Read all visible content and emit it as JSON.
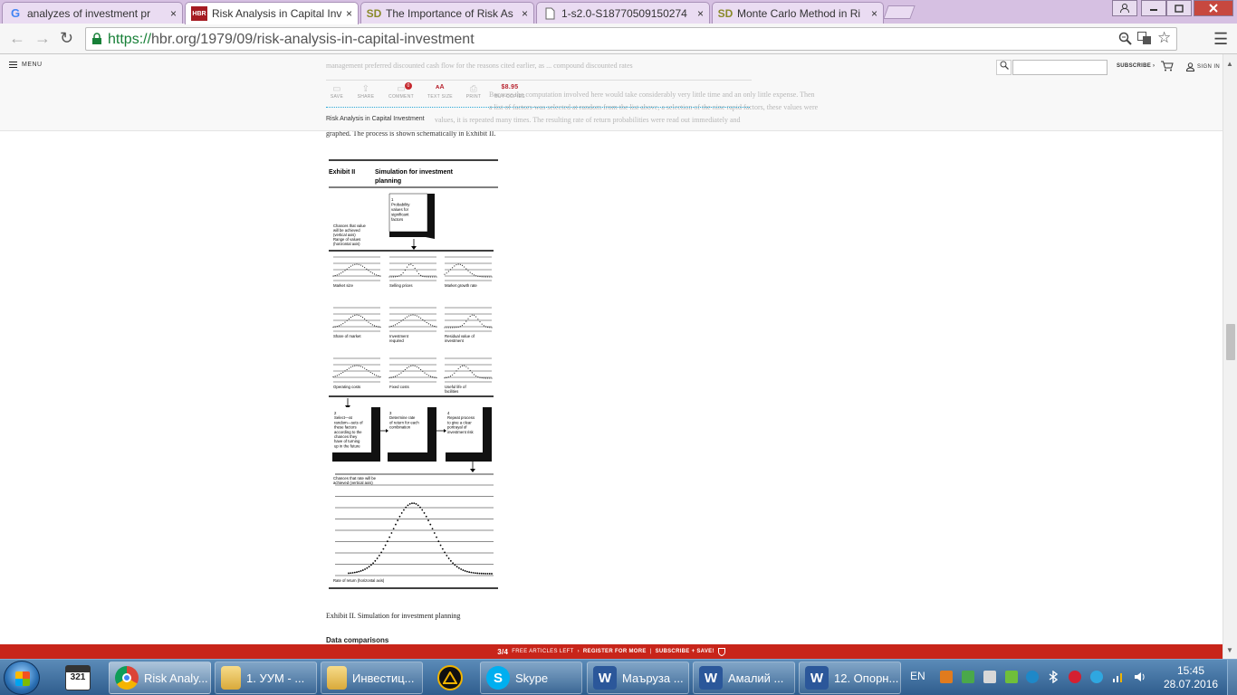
{
  "browser": {
    "tabs": [
      {
        "title": "analyzes of investment pr",
        "favicon": "google-icon",
        "active": false
      },
      {
        "title": "Risk Analysis in Capital Inv",
        "favicon": "hbr-icon",
        "active": true
      },
      {
        "title": "The Importance of Risk As",
        "favicon": "sciencedirect-icon",
        "active": false
      },
      {
        "title": "1-s2.0-S18770509150274",
        "favicon": "document-icon",
        "active": false
      },
      {
        "title": "Monte Carlo Method in Ri",
        "favicon": "sciencedirect-icon",
        "active": false
      }
    ],
    "hbr_favicon_text": "HBR",
    "sd_favicon_text": "SD",
    "close_glyph": "×",
    "url_scheme": "https://",
    "url_rest": "hbr.org/1979/09/risk-analysis-in-capital-investment"
  },
  "site": {
    "menu_label": "MENU",
    "search_placeholder": "",
    "subscribe_label": "SUBSCRIBE",
    "signin_label": "SIGN IN",
    "ghost_line_1": "management preferred discounted cash flow for the reasons cited earlier, as ... compound discounted rates",
    "ghost_line_2": "Because the computation involved here would take considerably very little time and an only little expense. Then",
    "ghost_line_3": "a list of factors was selected at random from the list above, a selection of the nine rapid factors, these values were",
    "ghost_line_4": "values, it is repeated many times. The resulting rate of return probabilities were read out immediately and",
    "toolbar": [
      {
        "label": "SAVE",
        "icon": "folder-icon",
        "glyph": "▭"
      },
      {
        "label": "SHARE",
        "icon": "share-icon",
        "glyph": "⇪"
      },
      {
        "label": "COMMENT",
        "icon": "comment-icon",
        "glyph": "▭",
        "badge": "0"
      },
      {
        "label": "TEXT SIZE",
        "icon": "text-size-icon",
        "glyph": "ᴀA"
      },
      {
        "label": "PRINT",
        "icon": "print-icon",
        "glyph": "⎙"
      },
      {
        "label": "BUY COPIES",
        "icon": "price-icon",
        "glyph": "$8.95"
      }
    ],
    "article_title": "Risk Analysis in Capital Investment"
  },
  "article": {
    "body_tail": "graphed. The process is shown schematically in Exhibit II.",
    "caption": "Exhibit II. Simulation for investment planning",
    "next_heading": "Data comparisons"
  },
  "exhibit": {
    "label": "Exhibit II",
    "title_line1": "Simulation for investment",
    "title_line2": "planning",
    "step1_lines": [
      "1",
      "Probability",
      "values for",
      "significant",
      "factors"
    ],
    "axis_note_lines": [
      "Chances that value",
      "will be achieved",
      "(vertical axis)",
      "Range of values",
      "(horizontal axis)"
    ],
    "factors": [
      {
        "label": [
          "Market size"
        ]
      },
      {
        "label": [
          "Selling prices"
        ]
      },
      {
        "label": [
          "Market growth rate"
        ]
      },
      {
        "label": [
          "Share of market"
        ]
      },
      {
        "label": [
          "Investment",
          "required"
        ]
      },
      {
        "label": [
          "Residual value of",
          "investment"
        ]
      },
      {
        "label": [
          "Operating costs"
        ]
      },
      {
        "label": [
          "Fixed costs"
        ]
      },
      {
        "label": [
          "Useful life of",
          "facilities"
        ]
      }
    ],
    "step2_lines": [
      "2",
      "Select—at",
      "random—sets of",
      "these factors",
      "according to the",
      "chances they",
      "have of turning",
      "up in the future"
    ],
    "step3_lines": [
      "3",
      "Determine rate",
      "of return for each",
      "combination"
    ],
    "step4_lines": [
      "4",
      "Repeat process",
      "to give a clear",
      "portrayal of",
      "investment risk"
    ],
    "result_ylabel": [
      "Chances that rate will be",
      "achieved (vertical axis)"
    ],
    "result_xlabel": "Rate of return (horizontal axis)"
  },
  "meter": {
    "count": "3/4",
    "left_text": "FREE ARTICLES LEFT",
    "register_text": "REGISTER FOR MORE",
    "subscribe_text": "SUBSCRIBE + SAVE!"
  },
  "taskbar": {
    "items": [
      {
        "label": "Risk Analy...",
        "icon": "chrome-icon",
        "active": true
      },
      {
        "label": "1. УУМ - ...",
        "icon": "folder-icon",
        "active": false
      },
      {
        "label": "Инвестиц...",
        "icon": "folder-icon",
        "active": false
      },
      {
        "label": "Skype",
        "icon": "skype-icon",
        "active": false
      },
      {
        "label": "Маъруза ...",
        "icon": "word-icon",
        "active": false
      },
      {
        "label": "Амалий ...",
        "icon": "word-icon",
        "active": false
      },
      {
        "label": "12. Опорн...",
        "icon": "word-icon",
        "active": false
      }
    ],
    "pinned_calendar_text": "321",
    "language": "EN",
    "time": "15:45",
    "date": "28.07.2016"
  }
}
